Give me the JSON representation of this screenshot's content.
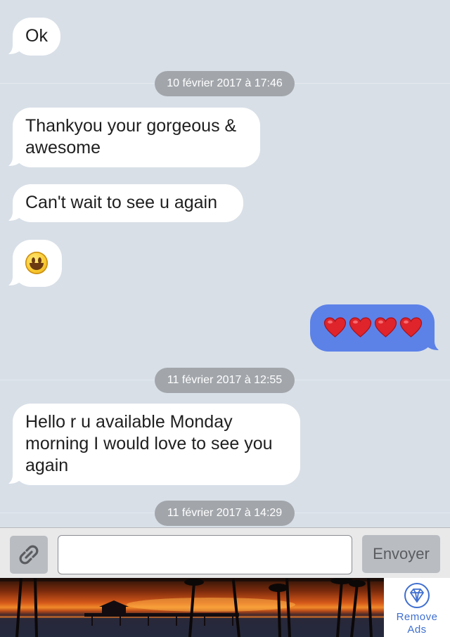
{
  "colors": {
    "background": "#d8dfe7",
    "incoming_bubble": "#ffffff",
    "outgoing_bubble": "#5c82e8",
    "timestamp_pill": "#a2a6ab",
    "link_blue": "#3f6fd0"
  },
  "messages": [
    {
      "direction": "incoming",
      "text": "Ok"
    },
    {
      "type": "timestamp",
      "text": "10 février 2017 à 17:46"
    },
    {
      "direction": "incoming",
      "lines": [
        "Thankyou your gorgeous &",
        "awesome"
      ]
    },
    {
      "direction": "incoming",
      "text": "Can't wait to see u again"
    },
    {
      "direction": "incoming",
      "emoji": "grinning-face-emoji"
    },
    {
      "direction": "outgoing",
      "emoji": "red-heart-emoji",
      "count": 4
    },
    {
      "type": "timestamp",
      "text": "11 février 2017 à 12:55"
    },
    {
      "direction": "incoming",
      "lines": [
        "Hello r u available Monday",
        "morning I would love to see you",
        "again"
      ]
    },
    {
      "type": "timestamp",
      "text": "11 février 2017 à 14:29"
    }
  ],
  "input_bar": {
    "attach_icon": "paperclip-icon",
    "message_value": "",
    "send_label": "Envoyer"
  },
  "ad_banner": {
    "image_description": "sunset-pier-palm-trees-photo",
    "remove_ads_icon": "diamond-icon",
    "remove_ads_label": "Remove\nAds"
  }
}
